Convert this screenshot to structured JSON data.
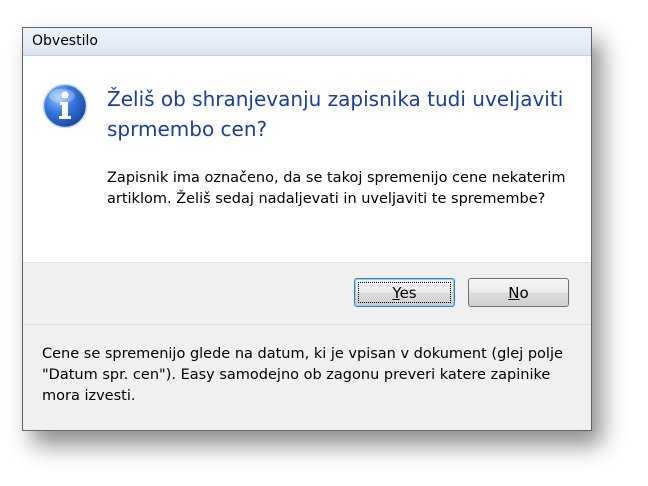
{
  "dialog": {
    "title": "Obvestilo",
    "icon": "info-icon",
    "main_instruction": "Želiš ob shranjevanju zapisnika tudi uveljaviti sprmembo cen?",
    "content": "Zapisnik ima označeno, da se takoj spremenijo cene nekaterim artiklom. Želiš sedaj nadaljevati in uveljaviti te spremembe?",
    "buttons": {
      "yes_mnemonic": "Y",
      "yes_rest": "es",
      "no_mnemonic": "N",
      "no_rest": "o"
    },
    "footer": "Cene se spremenijo glede na datum, ki je vpisan v dokument (glej polje \"Datum spr. cen\"). Easy samodejno ob zagonu preveri katere zapinike mora izvesti."
  },
  "colors": {
    "instruction_text": "#1a3e9e",
    "icon_blue": "#2a63c4"
  }
}
